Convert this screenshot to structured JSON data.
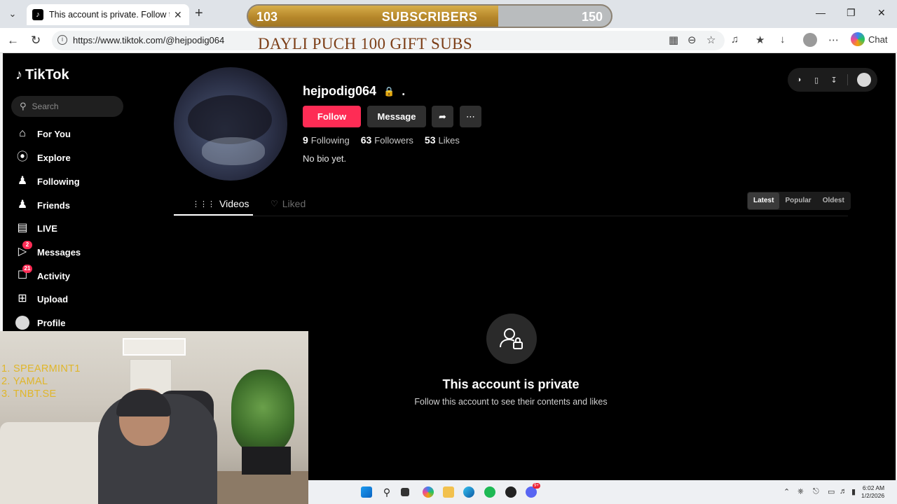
{
  "browser": {
    "tab_title": "This account is private. Follow this",
    "tab_favicon": "tiktok-note-icon",
    "url": "https://www.tiktok.com/@hejpodig064",
    "chat_label": "Chat"
  },
  "stream_overlay": {
    "sub_current": "103",
    "sub_label": "SUBSCRIBERS",
    "sub_goal": "150",
    "sub_progress": 0.69,
    "banner_text": "DAYLI  PUCH 100 GIFT SUBS",
    "leaderboard": [
      "1.  SPEARMINT1",
      "2.  YAMAL",
      "3.  TNBT.SE"
    ]
  },
  "sidebar": {
    "logo": "TikTok",
    "search_placeholder": "Search",
    "items": [
      {
        "label": "For You",
        "icon": "home-icon"
      },
      {
        "label": "Explore",
        "icon": "compass-icon"
      },
      {
        "label": "Following",
        "icon": "user-follow-icon"
      },
      {
        "label": "Friends",
        "icon": "friends-icon"
      },
      {
        "label": "LIVE",
        "icon": "live-tv-icon"
      },
      {
        "label": "Messages",
        "icon": "send-icon",
        "badge": "2"
      },
      {
        "label": "Activity",
        "icon": "inbox-icon",
        "badge": "21"
      },
      {
        "label": "Upload",
        "icon": "upload-plus-icon"
      },
      {
        "label": "Profile",
        "icon": "profile-avatar"
      }
    ]
  },
  "profile": {
    "username": "hejpodig064",
    "nickname": ".",
    "follow_label": "Follow",
    "message_label": "Message",
    "stats": [
      {
        "value": "9",
        "label": "Following"
      },
      {
        "value": "63",
        "label": "Followers"
      },
      {
        "value": "53",
        "label": "Likes"
      }
    ],
    "bio": "No bio yet."
  },
  "content_tabs": {
    "videos": "Videos",
    "liked": "Liked",
    "sort": [
      "Latest",
      "Popular",
      "Oldest"
    ],
    "active_sort": "Latest"
  },
  "private_notice": {
    "title": "This account is private",
    "subtitle": "Follow this account to see their contents and likes"
  },
  "taskbar": {
    "time": "6:02 AM",
    "date": "1/2/2026",
    "notification_badge": "9+"
  }
}
